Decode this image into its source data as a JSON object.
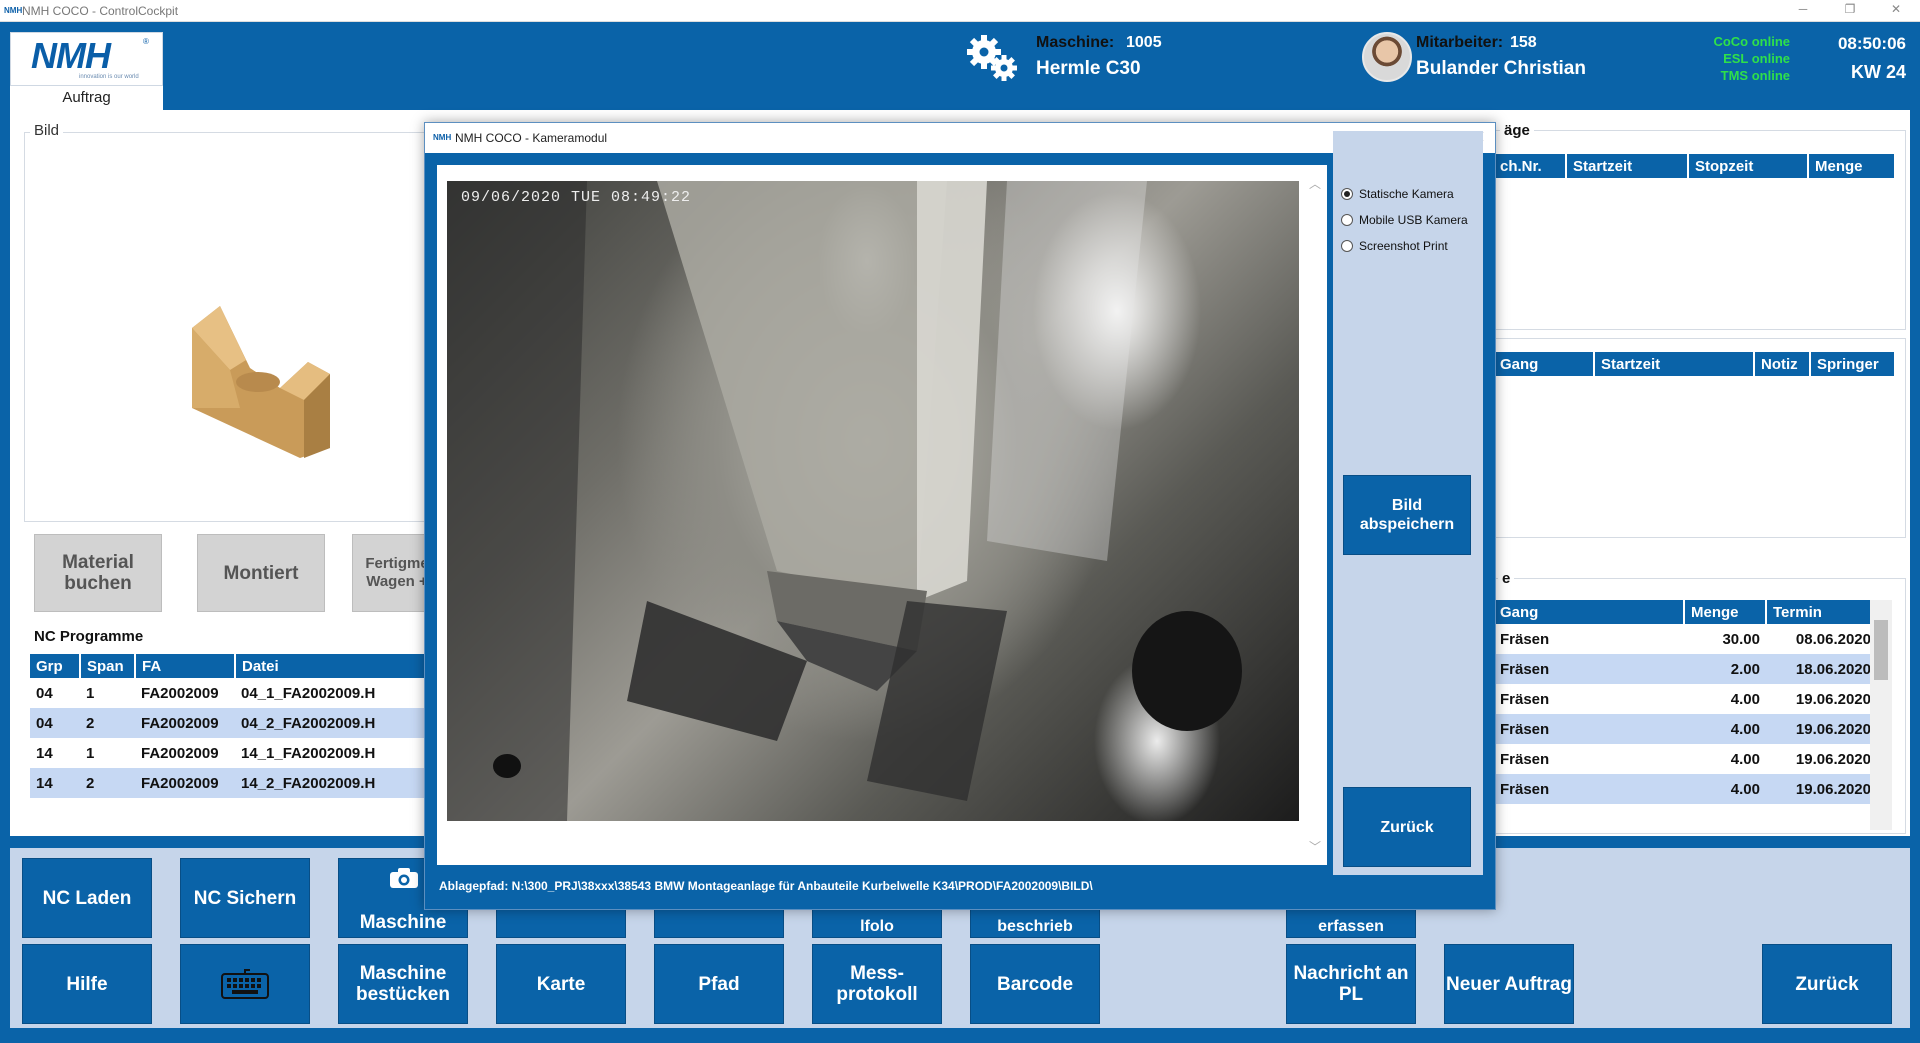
{
  "window": {
    "title": "NMH COCO - ControlCockpit",
    "icon_text": "NMH"
  },
  "header": {
    "logo": {
      "text": "NMH",
      "reg": "®",
      "tagline": "innovation is our world"
    },
    "tab": "Auftrag",
    "machine_label": "Maschine:",
    "machine_number": "1005",
    "machine_name": "Hermle C30",
    "employee_label": "Mitarbeiter:",
    "employee_number": "158",
    "employee_name": "Bulander Christian",
    "status": [
      "CoCo online",
      "ESL online",
      "TMS online"
    ],
    "time": "08:50:06",
    "week": "KW 24"
  },
  "left": {
    "bild_title": "Bild",
    "buttons": [
      "Material buchen",
      "Montiert",
      "Fertigme Wagen +"
    ],
    "nc_title": "NC Programme",
    "nc_columns": [
      "Grp",
      "Span",
      "FA",
      "Datei"
    ],
    "nc_rows": [
      [
        "04",
        "1",
        "FA2002009",
        "04_1_FA2002009.H"
      ],
      [
        "04",
        "2",
        "FA2002009",
        "04_2_FA2002009.H"
      ],
      [
        "14",
        "1",
        "FA2002009",
        "14_1_FA2002009.H"
      ],
      [
        "14",
        "2",
        "FA2002009",
        "14_2_FA2002009.H"
      ]
    ]
  },
  "right": {
    "panel1_title": "äge",
    "panel1_columns": [
      "ch.Nr.",
      "Startzeit",
      "Stopzeit",
      "Menge"
    ],
    "panel2_columns": [
      "Gang",
      "Startzeit",
      "Notiz",
      "Springer"
    ],
    "panel3_title": "e",
    "panel3_columns": [
      "Gang",
      "Menge",
      "Termin"
    ],
    "panel3_rows": [
      [
        "Fräsen",
        "30.00",
        "08.06.2020"
      ],
      [
        "Fräsen",
        "2.00",
        "18.06.2020"
      ],
      [
        "Fräsen",
        "4.00",
        "19.06.2020"
      ],
      [
        "Fräsen",
        "4.00",
        "19.06.2020"
      ],
      [
        "Fräsen",
        "4.00",
        "19.06.2020"
      ],
      [
        "Fräsen",
        "4.00",
        "19.06.2020"
      ]
    ]
  },
  "bottom": {
    "row1": [
      "NC Laden",
      "NC Sichern",
      "Maschine"
    ],
    "row1_partial": [
      "lfolo",
      "beschrieb",
      "erfassen"
    ],
    "row2": [
      "Hilfe",
      "",
      "Maschine bestücken",
      "Karte",
      "Pfad",
      "Mess-protokoll",
      "Barcode",
      "Nachricht an PL",
      "Neuer Auftrag",
      "Zurück"
    ]
  },
  "dialog": {
    "title": "NMH COCO - Kameramodul",
    "icon_text": "NMH",
    "timestamp": "09/06/2020 TUE 08:49:22",
    "radios": [
      {
        "label": "Statische Kamera",
        "checked": true
      },
      {
        "label": "Mobile USB Kamera",
        "checked": false
      },
      {
        "label": "Screenshot Print",
        "checked": false
      }
    ],
    "save_button": "Bild abspeichern",
    "back_button": "Zurück",
    "path": "Ablagepfad: N:\\300_PRJ\\38xxx\\38543 BMW Montageanlage für Anbauteile Kurbelwelle K34\\PROD\\FA2002009\\BILD\\"
  },
  "colors": {
    "primary": "#0a63a8",
    "row_alt": "#c6d8f3",
    "status_green": "#2fe04a",
    "panel_bg": "#c6d5ea"
  }
}
